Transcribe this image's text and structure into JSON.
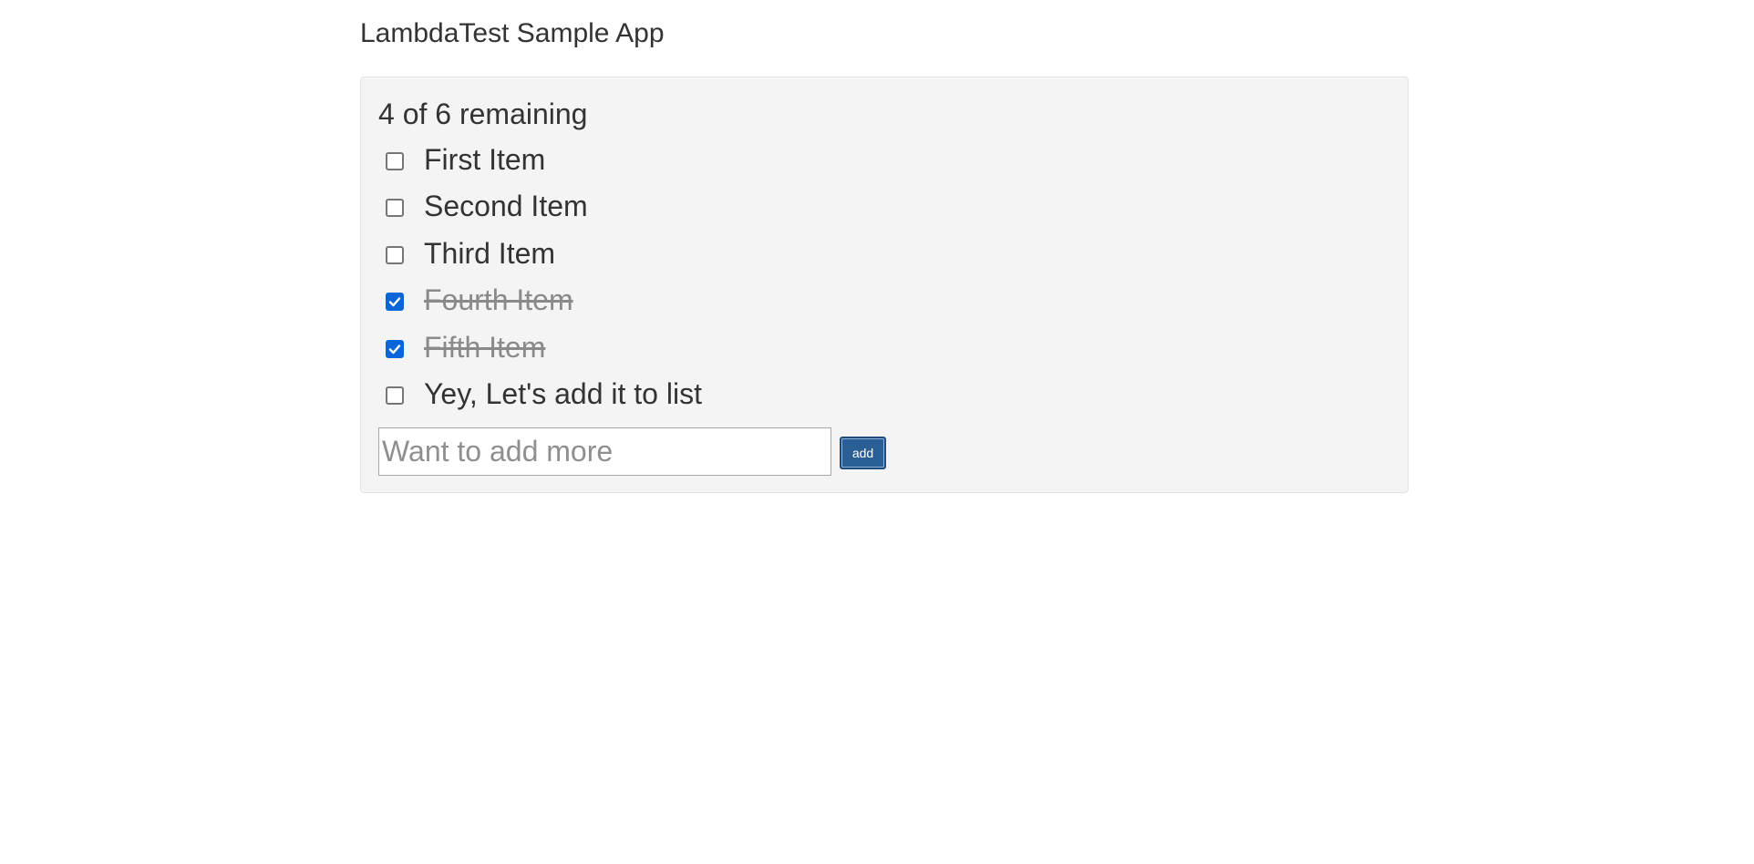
{
  "app": {
    "title": "LambdaTest Sample App"
  },
  "panel": {
    "remaining_text": "4 of 6 remaining",
    "items": [
      {
        "label": "First Item",
        "checked": false
      },
      {
        "label": "Second Item",
        "checked": false
      },
      {
        "label": "Third Item",
        "checked": false
      },
      {
        "label": "Fourth Item",
        "checked": true
      },
      {
        "label": "Fifth Item",
        "checked": true
      },
      {
        "label": "Yey, Let's add it to list",
        "checked": false
      }
    ],
    "input": {
      "value": "",
      "placeholder": "Want to add more"
    },
    "add_button_label": "add"
  },
  "colors": {
    "checked": "#0a66d8",
    "button": "#2a5f96",
    "panel_bg": "#f4f4f4"
  }
}
